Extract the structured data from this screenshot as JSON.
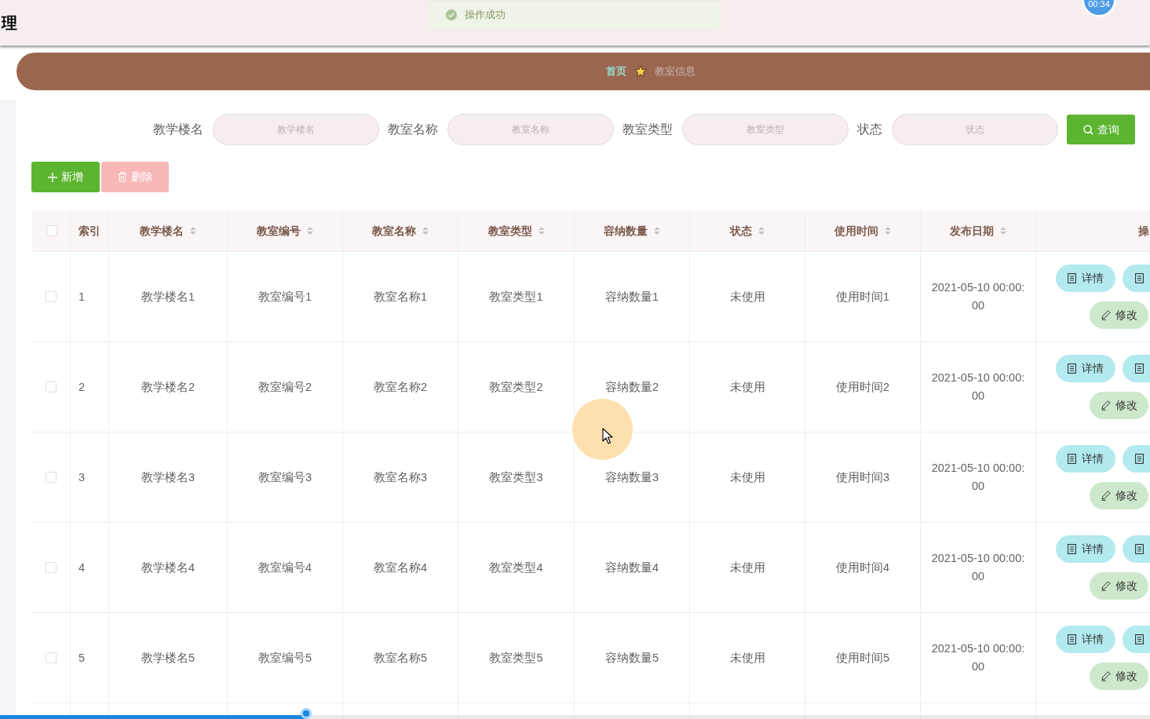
{
  "header": {
    "title": "理",
    "timer": "00:34"
  },
  "toast": {
    "message": "操作成功"
  },
  "breadcrumb": [
    {
      "label": "首页",
      "current": false
    },
    {
      "label": "教室信息",
      "current": true
    }
  ],
  "search": {
    "fields": [
      {
        "label": "教学楼名",
        "placeholder": "教学楼名"
      },
      {
        "label": "教室名称",
        "placeholder": "教室名称"
      },
      {
        "label": "教室类型",
        "placeholder": "教室类型"
      },
      {
        "label": "状态",
        "placeholder": "状态"
      }
    ],
    "button": "查询"
  },
  "toolbar": [
    {
      "kind": "add",
      "label": "新增",
      "disabled": false
    },
    {
      "kind": "delete",
      "label": "删除",
      "disabled": true
    }
  ],
  "table": {
    "checked": false,
    "columns": [
      {
        "label": "索引",
        "sortable": false
      },
      {
        "label": "教学楼名",
        "sortable": true
      },
      {
        "label": "教室编号",
        "sortable": true
      },
      {
        "label": "教室名称",
        "sortable": true
      },
      {
        "label": "教室类型",
        "sortable": true
      },
      {
        "label": "容纳数量",
        "sortable": true
      },
      {
        "label": "状态",
        "sortable": true
      },
      {
        "label": "使用时间",
        "sortable": true
      },
      {
        "label": "发布日期",
        "sortable": true
      },
      {
        "label": "操",
        "sortable": false
      }
    ],
    "rows": [
      {
        "checked": false,
        "cells": [
          "1",
          "教学楼名1",
          "教室编号1",
          "教室名称1",
          "教室类型1",
          "容纳数量1",
          "未使用",
          "使用时间1",
          "2021-05-10 00:00:00"
        ],
        "buttons": [
          {
            "kind": "detail",
            "label": "详情"
          },
          {
            "kind": "detail_cut"
          },
          {
            "kind": "edit",
            "label": "修改"
          }
        ]
      },
      {
        "checked": false,
        "cells": [
          "2",
          "教学楼名2",
          "教室编号2",
          "教室名称2",
          "教室类型2",
          "容纳数量2",
          "未使用",
          "使用时间2",
          "2021-05-10 00:00:00"
        ],
        "buttons": [
          {
            "kind": "detail",
            "label": "详情"
          },
          {
            "kind": "detail_cut"
          },
          {
            "kind": "edit",
            "label": "修改"
          }
        ]
      },
      {
        "checked": false,
        "cells": [
          "3",
          "教学楼名3",
          "教室编号3",
          "教室名称3",
          "教室类型3",
          "容纳数量3",
          "未使用",
          "使用时间3",
          "2021-05-10 00:00:00"
        ],
        "buttons": [
          {
            "kind": "detail",
            "label": "详情"
          },
          {
            "kind": "detail_cut"
          },
          {
            "kind": "edit",
            "label": "修改"
          }
        ]
      },
      {
        "checked": false,
        "cells": [
          "4",
          "教学楼名4",
          "教室编号4",
          "教室名称4",
          "教室类型4",
          "容纳数量4",
          "未使用",
          "使用时间4",
          "2021-05-10 00:00:00"
        ],
        "buttons": [
          {
            "kind": "detail",
            "label": "详情"
          },
          {
            "kind": "detail_cut"
          },
          {
            "kind": "edit",
            "label": "修改"
          }
        ]
      },
      {
        "checked": false,
        "cells": [
          "5",
          "教学楼名5",
          "教室编号5",
          "教室名称5",
          "教室类型5",
          "容纳数量5",
          "未使用",
          "使用时间5",
          "2021-05-10 00:00:00"
        ],
        "buttons": [
          {
            "kind": "detail",
            "label": "详情"
          },
          {
            "kind": "detail_cut"
          },
          {
            "kind": "edit",
            "label": "修改"
          }
        ]
      }
    ]
  },
  "playback": {
    "level": 0.266
  }
}
